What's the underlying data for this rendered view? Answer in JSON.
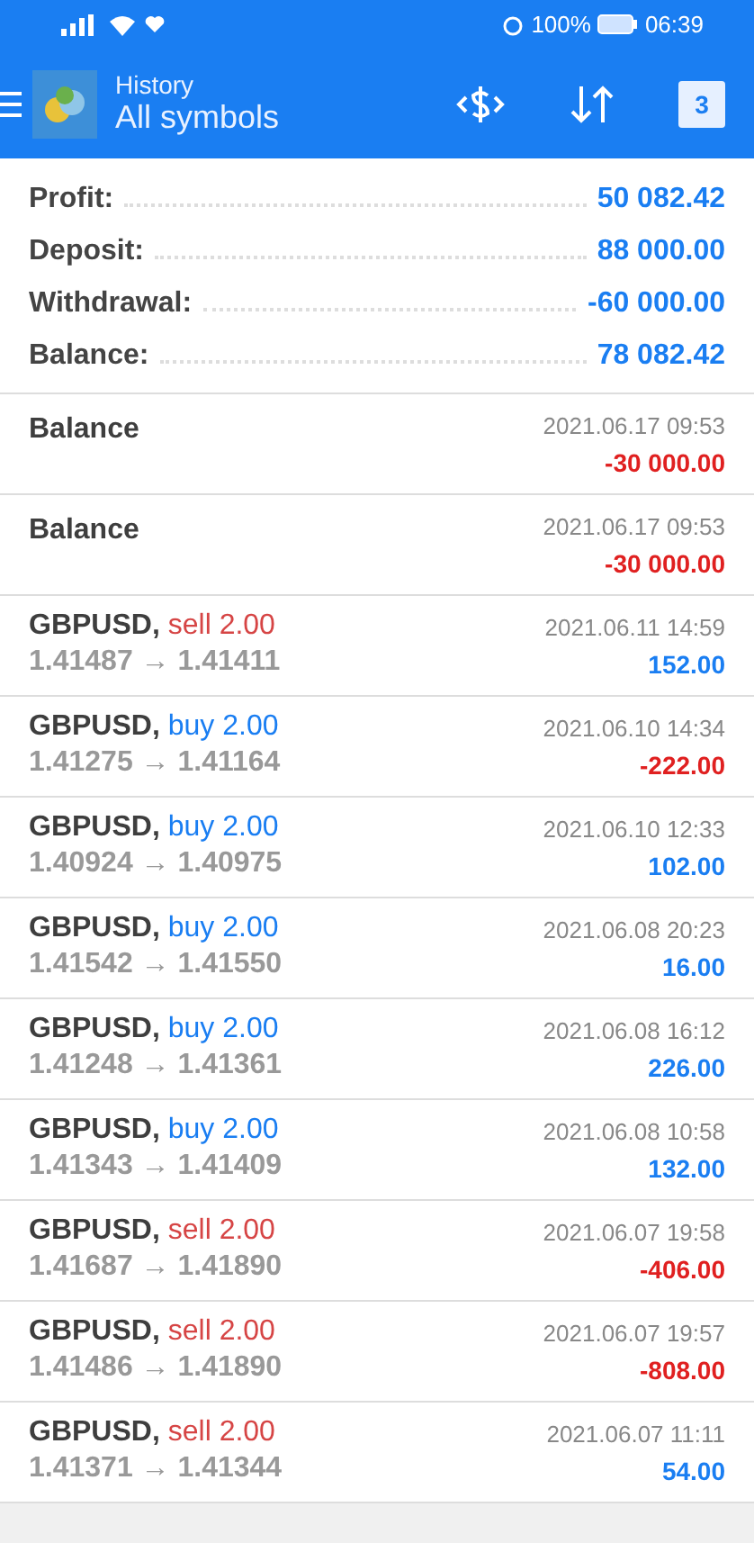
{
  "status_bar": {
    "time": "06:39",
    "battery": "100%"
  },
  "header": {
    "title": "History",
    "subtitle": "All symbols",
    "calendar_day": "3"
  },
  "summary": [
    {
      "label": "Profit:",
      "value": "50 082.42"
    },
    {
      "label": "Deposit:",
      "value": "88 000.00"
    },
    {
      "label": "Withdrawal:",
      "value": "-60 000.00"
    },
    {
      "label": "Balance:",
      "value": "78 082.42"
    }
  ],
  "deals": [
    {
      "kind": "balance",
      "title": "Balance",
      "time": "2021.06.17 09:53",
      "amount": "-30 000.00",
      "negative": true
    },
    {
      "kind": "balance",
      "title": "Balance",
      "time": "2021.06.17 09:53",
      "amount": "-30 000.00",
      "negative": true
    },
    {
      "kind": "trade",
      "symbol": "GBPUSD,",
      "sell": true,
      "volume": "sell 2.00",
      "prices": "1.41487 → 1.41411",
      "time": "2021.06.11 14:59",
      "amount": "152.00",
      "negative": false
    },
    {
      "kind": "trade",
      "symbol": "GBPUSD,",
      "sell": false,
      "volume": "buy 2.00",
      "prices": "1.41275 → 1.41164",
      "time": "2021.06.10 14:34",
      "amount": "-222.00",
      "negative": true
    },
    {
      "kind": "trade",
      "symbol": "GBPUSD,",
      "sell": false,
      "volume": "buy 2.00",
      "prices": "1.40924 → 1.40975",
      "time": "2021.06.10 12:33",
      "amount": "102.00",
      "negative": false
    },
    {
      "kind": "trade",
      "symbol": "GBPUSD,",
      "sell": false,
      "volume": "buy 2.00",
      "prices": "1.41542 → 1.41550",
      "time": "2021.06.08 20:23",
      "amount": "16.00",
      "negative": false
    },
    {
      "kind": "trade",
      "symbol": "GBPUSD,",
      "sell": false,
      "volume": "buy 2.00",
      "prices": "1.41248 → 1.41361",
      "time": "2021.06.08 16:12",
      "amount": "226.00",
      "negative": false
    },
    {
      "kind": "trade",
      "symbol": "GBPUSD,",
      "sell": false,
      "volume": "buy 2.00",
      "prices": "1.41343 → 1.41409",
      "time": "2021.06.08 10:58",
      "amount": "132.00",
      "negative": false
    },
    {
      "kind": "trade",
      "symbol": "GBPUSD,",
      "sell": true,
      "volume": "sell 2.00",
      "prices": "1.41687 → 1.41890",
      "time": "2021.06.07 19:58",
      "amount": "-406.00",
      "negative": true
    },
    {
      "kind": "trade",
      "symbol": "GBPUSD,",
      "sell": true,
      "volume": "sell 2.00",
      "prices": "1.41486 → 1.41890",
      "time": "2021.06.07 19:57",
      "amount": "-808.00",
      "negative": true
    },
    {
      "kind": "trade",
      "symbol": "GBPUSD,",
      "sell": true,
      "volume": "sell 2.00",
      "prices": "1.41371 → 1.41344",
      "time": "2021.06.07 11:11",
      "amount": "54.00",
      "negative": false
    }
  ]
}
